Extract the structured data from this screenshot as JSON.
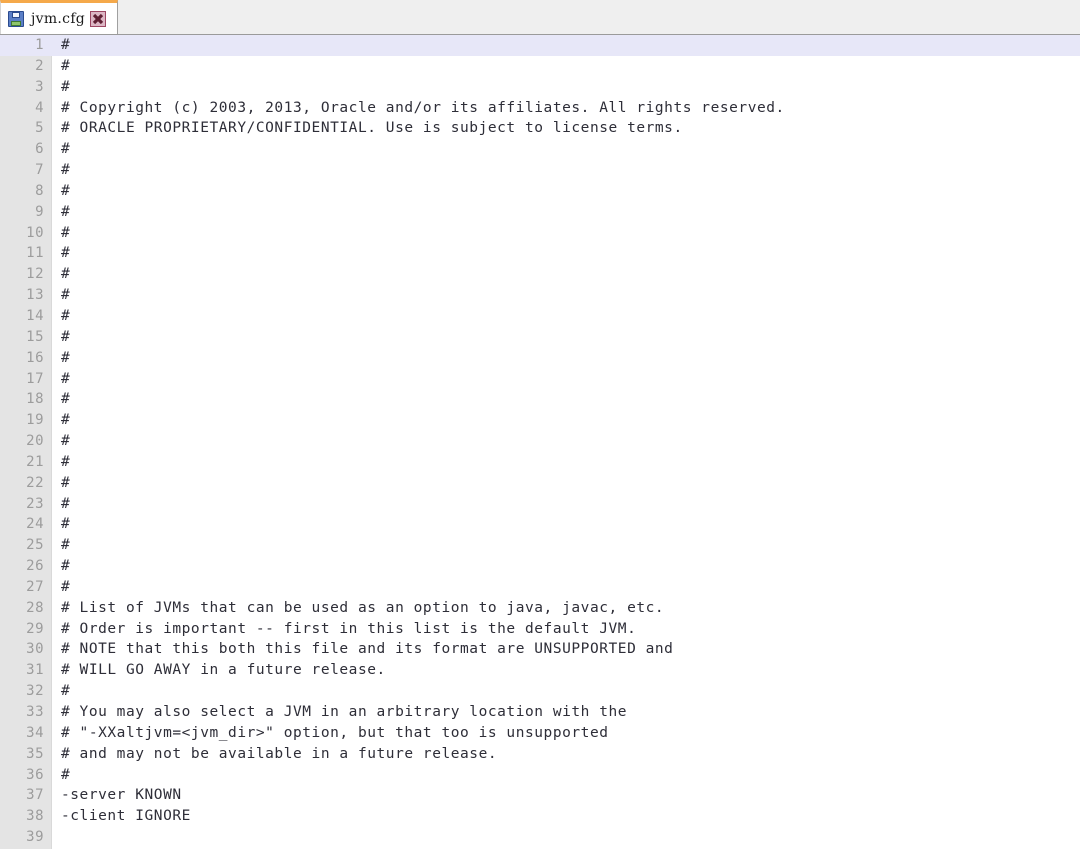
{
  "window": {
    "background_color": "#ffffff"
  },
  "tabbar": {
    "background_color": "#efefef",
    "active_tab_accent_color": "#f5a94a",
    "tabs": [
      {
        "title": "jvm.cfg",
        "icon": "floppy-disk-save-icon",
        "close_icon": "close-x-icon",
        "active": true,
        "modified": false
      }
    ]
  },
  "editor": {
    "gutter_background_color": "#e4e4e4",
    "line_number_color": "#9c9c9c",
    "text_color": "#2e2e38",
    "current_line": 1,
    "current_line_highlight_color": "#e7e7f8",
    "total_lines": 39,
    "lines": [
      {
        "n": "1",
        "text": "#"
      },
      {
        "n": "2",
        "text": "#"
      },
      {
        "n": "3",
        "text": "#"
      },
      {
        "n": "4",
        "text": "# Copyright (c) 2003, 2013, Oracle and/or its affiliates. All rights reserved."
      },
      {
        "n": "5",
        "text": "# ORACLE PROPRIETARY/CONFIDENTIAL. Use is subject to license terms."
      },
      {
        "n": "6",
        "text": "#"
      },
      {
        "n": "7",
        "text": "#"
      },
      {
        "n": "8",
        "text": "#"
      },
      {
        "n": "9",
        "text": "#"
      },
      {
        "n": "10",
        "text": "#"
      },
      {
        "n": "11",
        "text": "#"
      },
      {
        "n": "12",
        "text": "#"
      },
      {
        "n": "13",
        "text": "#"
      },
      {
        "n": "14",
        "text": "#"
      },
      {
        "n": "15",
        "text": "#"
      },
      {
        "n": "16",
        "text": "#"
      },
      {
        "n": "17",
        "text": "#"
      },
      {
        "n": "18",
        "text": "#"
      },
      {
        "n": "19",
        "text": "#"
      },
      {
        "n": "20",
        "text": "#"
      },
      {
        "n": "21",
        "text": "#"
      },
      {
        "n": "22",
        "text": "#"
      },
      {
        "n": "23",
        "text": "#"
      },
      {
        "n": "24",
        "text": "#"
      },
      {
        "n": "25",
        "text": "#"
      },
      {
        "n": "26",
        "text": "#"
      },
      {
        "n": "27",
        "text": "#"
      },
      {
        "n": "28",
        "text": "# List of JVMs that can be used as an option to java, javac, etc."
      },
      {
        "n": "29",
        "text": "# Order is important -- first in this list is the default JVM."
      },
      {
        "n": "30",
        "text": "# NOTE that this both this file and its format are UNSUPPORTED and"
      },
      {
        "n": "31",
        "text": "# WILL GO AWAY in a future release."
      },
      {
        "n": "32",
        "text": "#"
      },
      {
        "n": "33",
        "text": "# You may also select a JVM in an arbitrary location with the"
      },
      {
        "n": "34",
        "text": "# \"-XXaltjvm=<jvm_dir>\" option, but that too is unsupported"
      },
      {
        "n": "35",
        "text": "# and may not be available in a future release."
      },
      {
        "n": "36",
        "text": "#"
      },
      {
        "n": "37",
        "text": "-server KNOWN"
      },
      {
        "n": "38",
        "text": "-client IGNORE"
      },
      {
        "n": "39",
        "text": ""
      }
    ]
  }
}
